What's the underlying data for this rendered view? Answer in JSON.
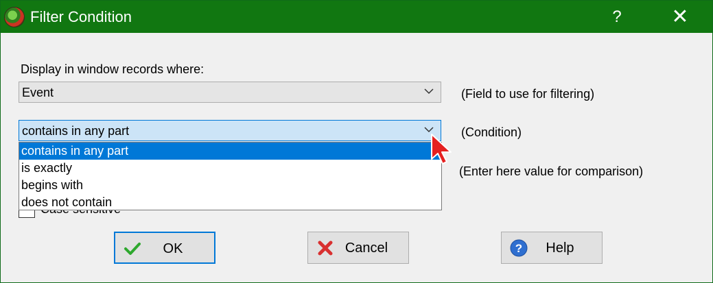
{
  "window": {
    "title": "Filter Condition",
    "help_glyph": "?",
    "close_glyph": "✕"
  },
  "form": {
    "display_label": "Display in window records where:",
    "field": {
      "value": "Event",
      "hint": "(Field to use for filtering)"
    },
    "condition": {
      "value": "contains in any part",
      "hint": "(Condition)",
      "options": [
        "contains in any part",
        "is exactly",
        "begins with",
        "does not contain"
      ],
      "selected_index": 0
    },
    "value_hint": "(Enter here value for comparison)",
    "case_sensitive": {
      "label": "Case sensitive",
      "checked": false
    }
  },
  "buttons": {
    "ok": "OK",
    "cancel": "Cancel",
    "help": "Help"
  },
  "colors": {
    "titlebar": "#117711",
    "selection": "#0078d7",
    "focus_fill": "#cce4f7"
  }
}
